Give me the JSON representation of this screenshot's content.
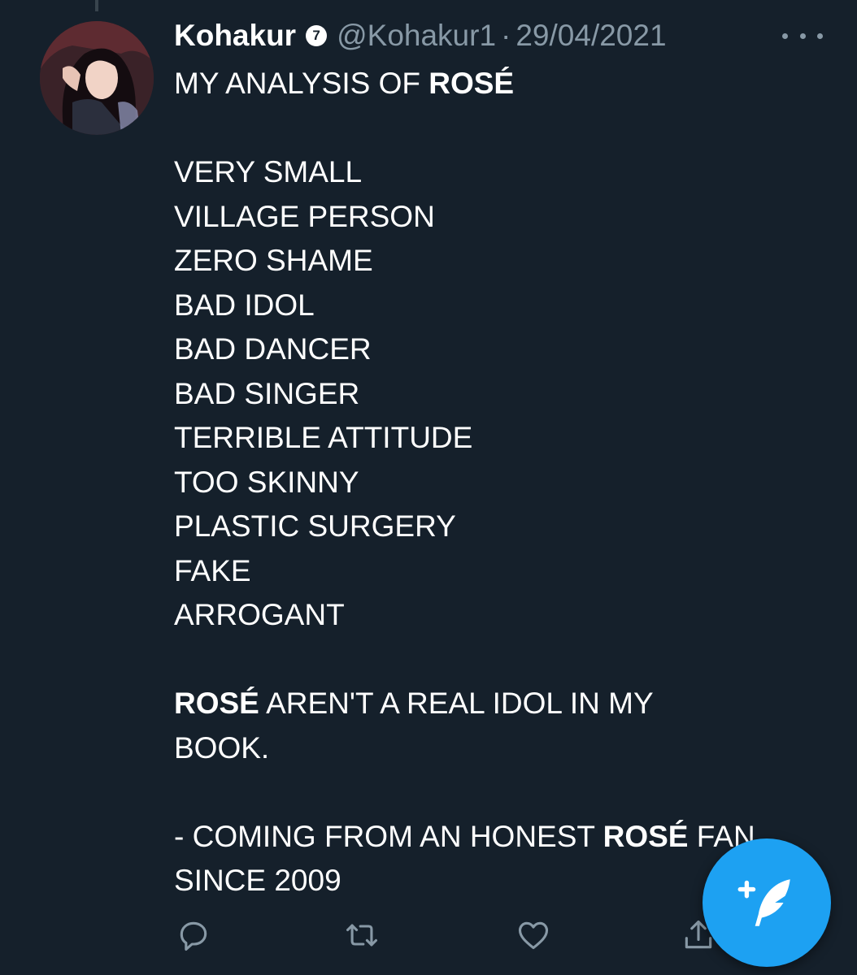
{
  "tweet": {
    "author": {
      "display_name": "Kohakur",
      "badge": "7",
      "handle": "@Kohakur1",
      "separator": "·",
      "date": "29/04/2021"
    },
    "body": {
      "line1_prefix": "MY ANALYSIS OF ",
      "line1_bold": "ROSÉ",
      "list": [
        "VERY SMALL",
        "VILLAGE PERSON",
        "ZERO SHAME",
        "BAD IDOL",
        "BAD DANCER",
        "BAD SINGER",
        "TERRIBLE ATTITUDE",
        "TOO SKINNY",
        "PLASTIC SURGERY",
        "FAKE",
        "ARROGANT"
      ],
      "verdict_bold": "ROSÉ",
      "verdict_rest": " AREN'T A REAL IDOL IN MY",
      "verdict_line2": "BOOK.",
      "closing_prefix": "- COMING FROM AN HONEST ",
      "closing_bold": "ROSÉ",
      "closing_suffix": " FAN",
      "closing_line2": "SINCE 2009"
    },
    "actions": {
      "reply_icon": "reply-icon",
      "retweet_icon": "retweet-icon",
      "like_icon": "heart-icon",
      "share_icon": "share-icon"
    }
  },
  "compose_button": {
    "icon": "compose-feather-icon"
  },
  "colors": {
    "background": "#15202b",
    "secondary_text": "#8899a6",
    "accent": "#1da1f2"
  }
}
